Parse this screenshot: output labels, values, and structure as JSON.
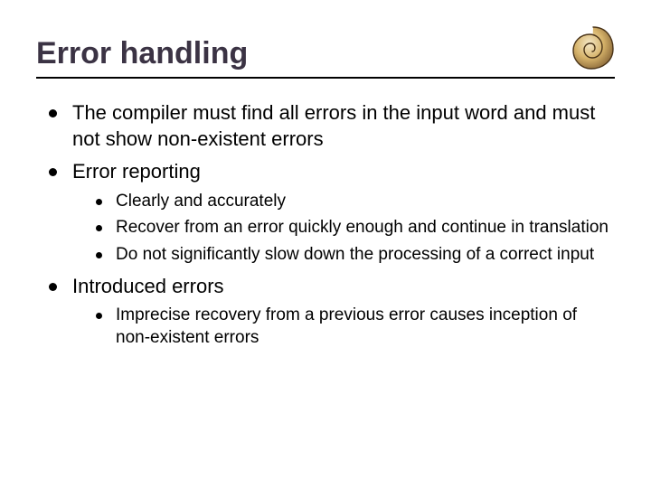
{
  "title": "Error handling",
  "bullets": {
    "b0": "The compiler must find all errors in the input word and must not show non-existent errors",
    "b1": "Error reporting",
    "b1_sub": {
      "s0": "Clearly and accurately",
      "s1": "Recover from an error quickly enough and continue in translation",
      "s2": "Do not significantly slow down the processing of a correct input"
    },
    "b2": "Introduced errors",
    "b2_sub": {
      "s0": "Imprecise recovery from a previous error causes inception of non-existent errors"
    }
  }
}
